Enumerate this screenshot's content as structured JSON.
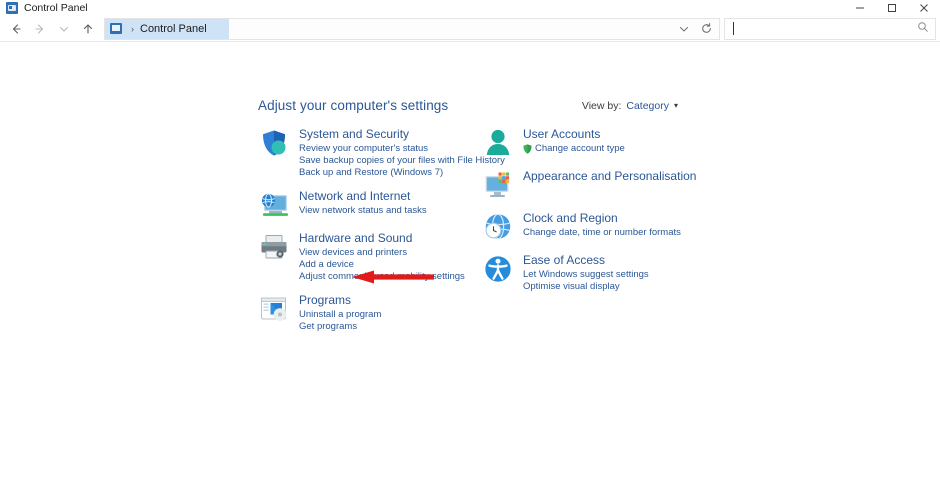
{
  "window": {
    "title": "Control Panel",
    "app_icon": "control-panel-icon",
    "controls": {
      "minimize": "minimize-icon",
      "maximize": "maximize-icon",
      "close": "close-icon"
    }
  },
  "navbar": {
    "back": "back-arrow-icon",
    "forward": "forward-arrow-icon",
    "recent": "chevron-down-icon",
    "up": "up-arrow-icon",
    "breadcrumb": {
      "icon": "control-panel-icon",
      "separator": "›",
      "path": "Control Panel"
    },
    "previous_locations": "chevron-down-icon",
    "refresh": "refresh-icon",
    "search": {
      "value": "",
      "placeholder": "",
      "icon": "search-icon"
    }
  },
  "main": {
    "heading": "Adjust your computer's settings",
    "view_by": {
      "label": "View by:",
      "value": "Category",
      "caret": "▾"
    },
    "left_column": [
      {
        "icon": "shield-icon",
        "title": "System and Security",
        "links": [
          "Review your computer's status",
          "Save backup copies of your files with File History",
          "Back up and Restore (Windows 7)"
        ]
      },
      {
        "icon": "network-globe-monitor-icon",
        "title": "Network and Internet",
        "links": [
          "View network status and tasks"
        ]
      },
      {
        "icon": "printer-icon",
        "title": "Hardware and Sound",
        "links": [
          "View devices and printers",
          "Add a device",
          "Adjust commonly used mobility settings"
        ]
      },
      {
        "icon": "programs-disc-icon",
        "title": "Programs",
        "links": [
          "Uninstall a program",
          "Get programs"
        ]
      }
    ],
    "right_column": [
      {
        "icon": "user-accounts-person-icon",
        "title": "User Accounts",
        "links": [
          "Change account type"
        ],
        "link_shield": true
      },
      {
        "icon": "appearance-monitor-icon",
        "title": "Appearance and Personalisation",
        "links": []
      },
      {
        "icon": "clock-globe-icon",
        "title": "Clock and Region",
        "links": [
          "Change date, time or number formats"
        ]
      },
      {
        "icon": "ease-of-access-icon",
        "title": "Ease of Access",
        "links": [
          "Let Windows suggest settings",
          "Optimise visual display"
        ]
      }
    ]
  },
  "annotation": {
    "arrow": "red-left-arrow",
    "color": "#E01B18",
    "points_to": "Programs"
  },
  "colors": {
    "link": "#2b5797",
    "heading": "#2b5797",
    "background": "#ffffff",
    "breadcrumb_highlight": "#cfe3f7",
    "annotation_red": "#E01B18"
  }
}
